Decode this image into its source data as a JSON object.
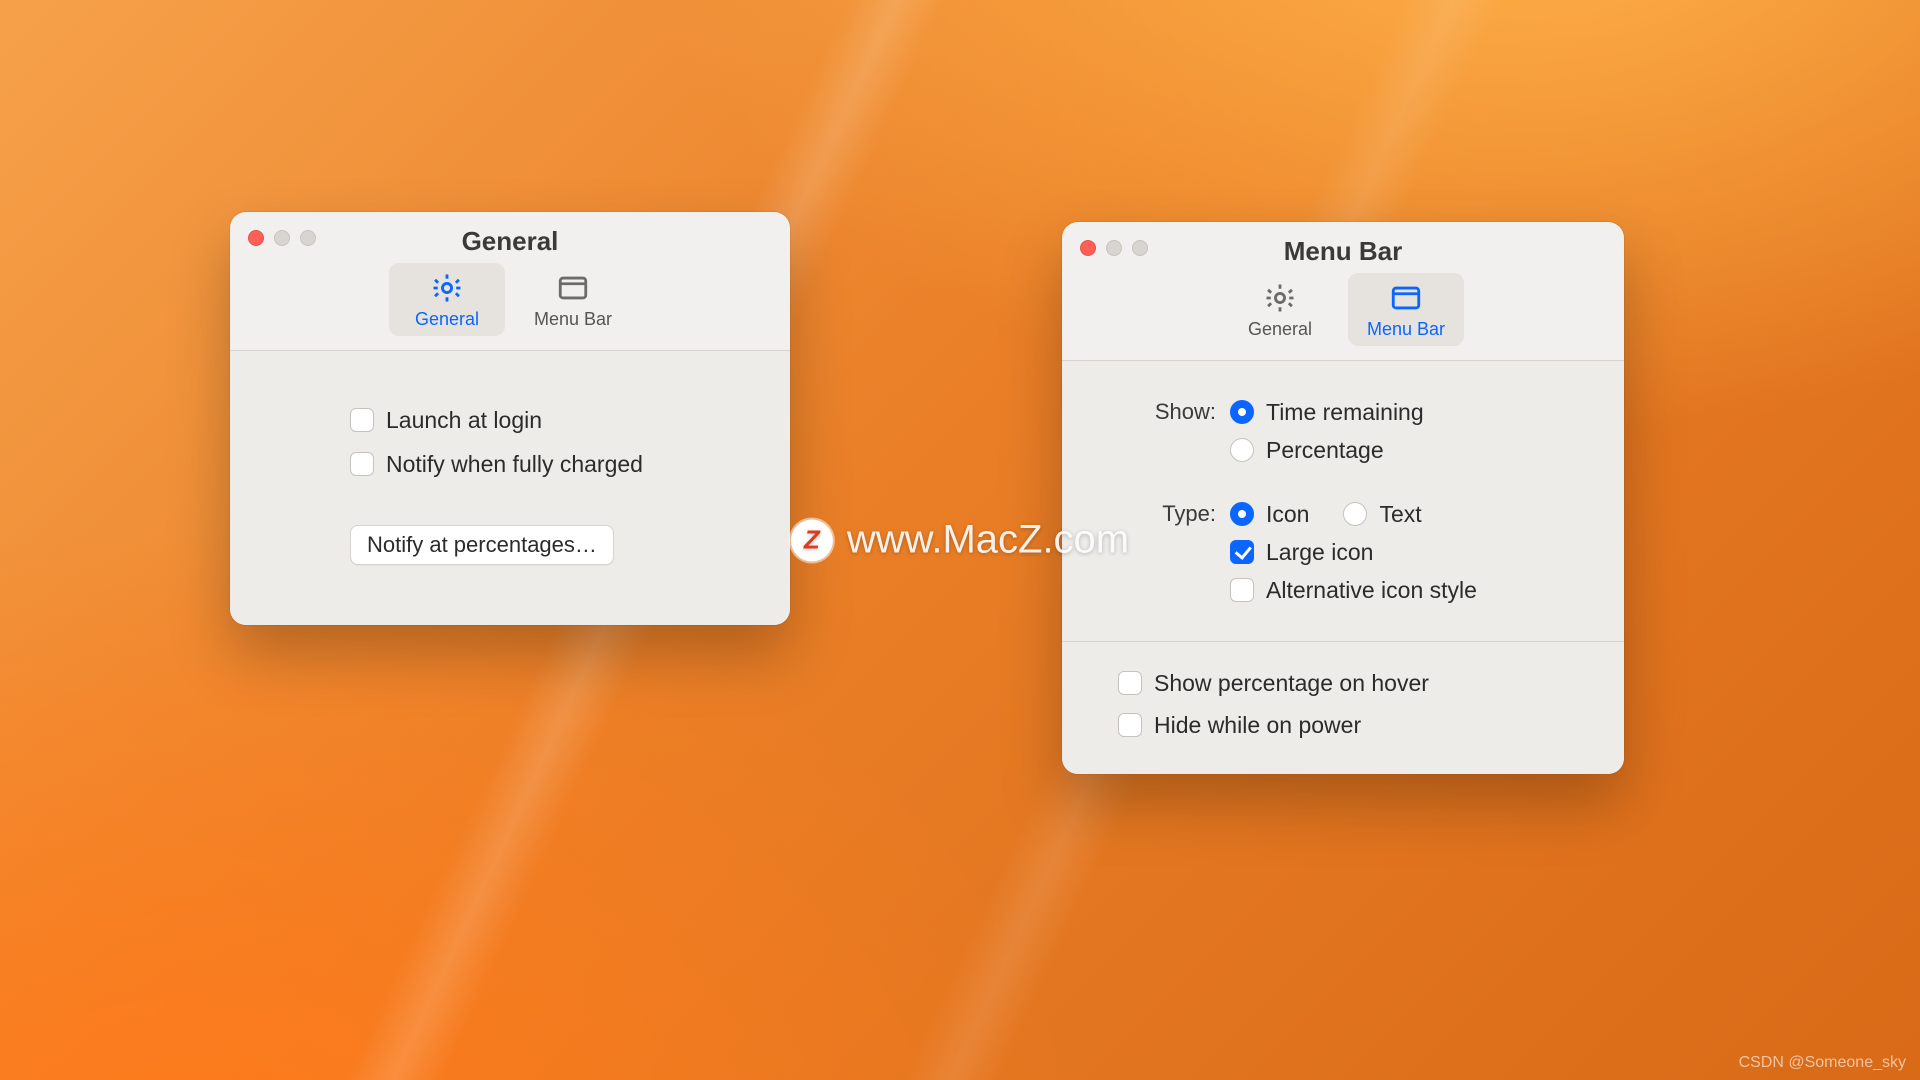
{
  "watermark": {
    "text": "www.MacZ.com",
    "badge": "Z"
  },
  "credit": "CSDN @Someone_sky",
  "windows": {
    "general": {
      "title": "General",
      "tabs": {
        "general": "General",
        "menubar": "Menu Bar"
      },
      "active_tab": "general",
      "options": {
        "launch_at_login": {
          "label": "Launch at login",
          "checked": false
        },
        "notify_full": {
          "label": "Notify when fully charged",
          "checked": false
        }
      },
      "button_notify_pct": "Notify at percentages…"
    },
    "menubar": {
      "title": "Menu Bar",
      "tabs": {
        "general": "General",
        "menubar": "Menu Bar"
      },
      "active_tab": "menubar",
      "show": {
        "label": "Show:",
        "time_remaining": {
          "label": "Time remaining",
          "selected": true
        },
        "percentage": {
          "label": "Percentage",
          "selected": false
        }
      },
      "type": {
        "label": "Type:",
        "icon": {
          "label": "Icon",
          "selected": true
        },
        "text": {
          "label": "Text",
          "selected": false
        },
        "large_icon": {
          "label": "Large icon",
          "checked": true
        },
        "alt_style": {
          "label": "Alternative icon style",
          "checked": false
        }
      },
      "extra": {
        "hover_pct": {
          "label": "Show percentage on hover",
          "checked": false
        },
        "hide_power": {
          "label": "Hide while on power",
          "checked": false
        }
      }
    }
  }
}
